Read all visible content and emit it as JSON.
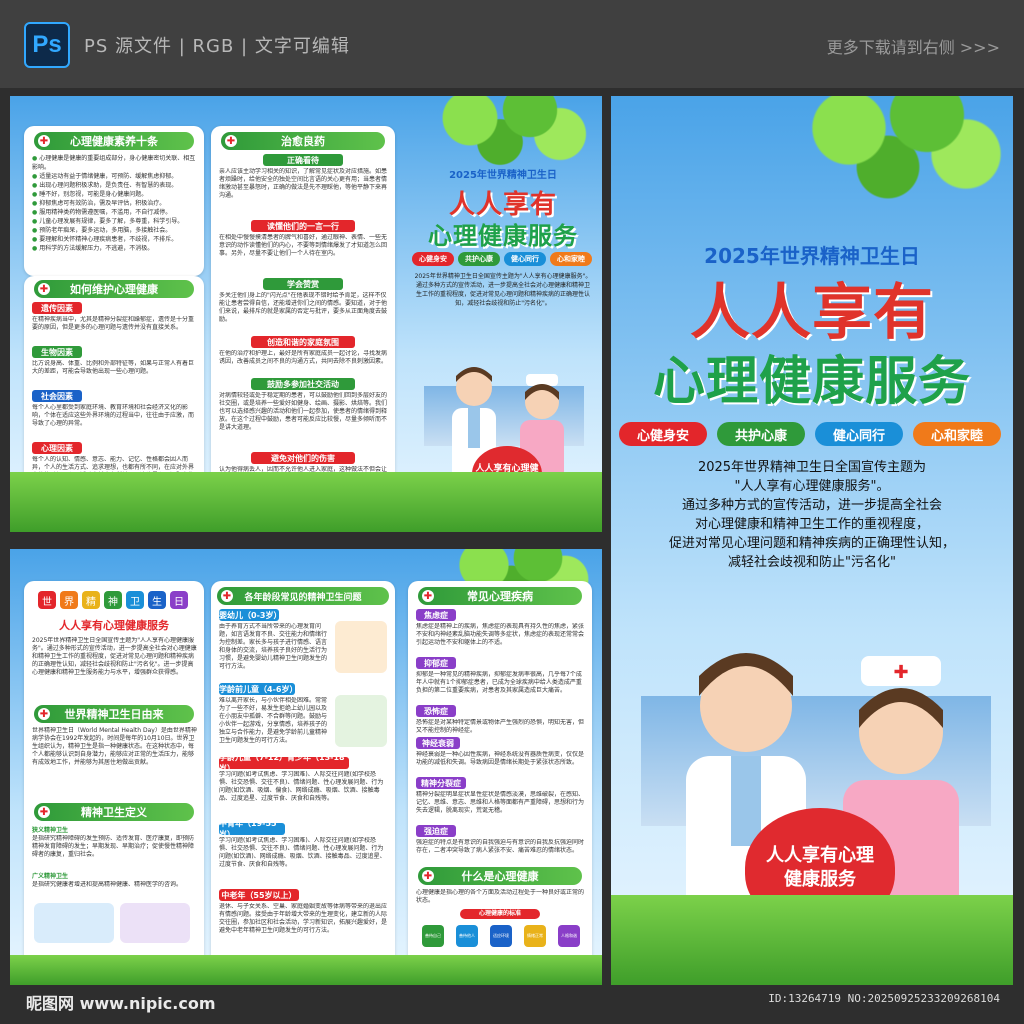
{
  "header": {
    "ps_label": "Ps",
    "left_text": "PS 源文件 | RGB | 文字可编辑",
    "right_text": "更多下载请到右侧 >>>"
  },
  "panel1": {
    "card1": {
      "title": "心理健康素养十条",
      "items": [
        "心理健康是健康的重要组成部分，身心健康密切关联、相互影响。",
        "适量运动有益于情绪健康，可预防、缓解焦虑抑郁。",
        "出现心理问题积极求助，是负责任、有智慧的表现。",
        "睡不好，别忽视，可能是身心健康问题。",
        "抑郁焦虑可有效防治，需及早评估，积极治疗。",
        "服用精神类药物需遵医嘱，不滥用，不自行减停。",
        "儿童心理发展有规律，要多了解，多尊重，科学引导。",
        "预防老年痴呆，要多运动，多用脑，多接触社会。",
        "要理解和关怀精神心理疾病患者，不歧视，不排斥。",
        "用科学的方法缓解压力，不逃避，不消极。"
      ]
    },
    "card2": {
      "title": "如何维护心理健康",
      "sections": [
        {
          "label": "遗传因素",
          "text": "在精神疾病当中，尤其是精神分裂症和躁郁症，遗传是十分重要的原因，但是更多的心理问题与遗传并没有直接关系。"
        },
        {
          "label": "生物因素",
          "text": "比方说身高、体重、比例和外部特征等，如果与正常人有着巨大的差距，可能会导致他出现一些心理问题。"
        },
        {
          "label": "社会因素",
          "text": "每个人心里都受到家庭环境、教育环境和社会经济文化的影响，个体在适应这些外界环境的过程当中，往往由于应激，而导致了心理的异常。"
        },
        {
          "label": "心理因素",
          "text": "每个人的认知、情感、意志、能力、记忆、性格都会因人而异，个人的生活方式、追求理想，也都有所不同，在应对外界事件的时候，心理活动自然会有所差异，这也是心理问题产生的一个重要原因。"
        }
      ]
    },
    "card3": {
      "title": "治愈良药",
      "sections": [
        {
          "label": "正确看待",
          "text": "亲人应该主动学习相关的知识，了解常见症状及对应措施。如患者烦躁时，给他安全的独处空间比言语的关心更有用；当患者情绪激动甚至暴怒时，正确的做法是先不理睬他，等他平静下来再沟通。"
        },
        {
          "label": "读懂他们的一言一行",
          "text": "在相处中慢慢摸清患者的脾气和喜好，通过眼神、表情、一些无意识的动作读懂他们的内心，不要等到情绪爆发了才知道怎么回事。另外，尽量不要让他们一个人待在室内。"
        },
        {
          "label": "学会赞赏",
          "text": "多关注他们身上的\"闪光点\"在他表现不错时给予肯定，这样不仅能让患者尝得自信，还能增进你们之间的情感。要知道，对于他们来说，最排斥的就是家属的否定与批评，要多从正面角度去鼓励。"
        },
        {
          "label": "创造和谐的家庭氛围",
          "text": "在他的治疗和护理上，最好是所有家庭成员一起讨论，寻找发病诱因，改善成员之间不良的沟通方式，共同去除不良刺激因素。"
        },
        {
          "label": "鼓励多参加社交活动",
          "text": "对病情较轻或处于稳定期的患者，可以鼓励他们回到多层好友的社交圈，或是培养一些爱好如健身、绘画、摄影、烘焙等。我们也可以选择感兴趣的活动和他们一起参加，使患者的情绪得到释放。在这个过程中鼓励，患者可能反应比较慢，尽量多倾听而不是讲大道理。"
        },
        {
          "label": "避免对他们的伤害",
          "text": "认为他得病丢人，因而不允许他人进入家庭，这种做法不但会让患者自己不被家人接受，绝对不说带有伤害性的话语。"
        }
      ]
    },
    "cover": {
      "year": "2025年世界精神卫生日",
      "title1": "人人享有",
      "title2": "心理健康服务",
      "pills": [
        "心健身安",
        "共护心康",
        "健心同行",
        "心和家睦"
      ],
      "text": "2025年世界精神卫生日全国宣传主题为\"人人享有心理健康服务\"。通过多种方式的宣传活动，进一步提高全社会对心理健康和精神卫生工作的重视程度，促进对常见心理问题和精神疾病的正确理性认知，减轻社会歧视和防止\"污名化\"。",
      "heart": "人人享有心理健康服务"
    }
  },
  "panel2": {
    "left": {
      "badge_chars": [
        "世",
        "界",
        "精",
        "神",
        "卫",
        "生",
        "日"
      ],
      "title": "人人享有心理健康服务",
      "intro": "2025年世界精神卫生日全国宣传主题为\"人人享有心理健康服务\"。通过多种形式的宣传活动，进一步提高全社会对心理健康和精神卫生工作的重视程度，促进对常见心理问题和精神疾病的正确理性认知，减轻社会歧视和防止\"污名化\"。进一步提高心理健康和精神卫生服务能力与水平，增强群众获得感。",
      "origin_title": "世界精神卫生日由来",
      "origin_text": "世界精神卫生日（World Mental Health Day）是由世界精神病学协会在1992年发起的，时间是每年的10月10日。世界卫生组织认为，精神卫生是指一种健康状态。在这种状态中，每个人都能够认识到自身潜力，能够应对正常的生活压力，能够有成效地工作，并能够为其居住地做出贡献。",
      "def_title": "精神卫生定义",
      "def_items": [
        {
          "label": "狭义精神卫生",
          "text": "是指研究精神障碍的发生预防、适传发育、医疗康复，即预防精神发育障碍的发生；早期发现、早期治疗；促使慢性精神障碍者的康复，重归社会。"
        },
        {
          "label": "广义精神卫生",
          "text": "是指研究健康者增进和提高精神健康、精神医学的咨询。"
        }
      ]
    },
    "middle": {
      "title": "各年龄段常见的精神卫生问题",
      "sections": [
        {
          "label": "婴幼儿（0-3岁）",
          "text": "由于养育方式不当所带来的心理发育问题，如言语发育不良、交往能力和情绪行为控制差。家长多与孩子进行情感、语言和身体的交流，培养孩子良好的生活行为习惯，是避免婴幼儿精神卫生问题发生的可行方法。"
        },
        {
          "label": "学龄前儿童（4-6岁）",
          "text": "难以离开家长，与小伙伴相处困难。常常为了一些不好，易发生拒绝上幼儿园以及在小朋友中孤僻、不合群等问题。鼓励与小伙伴一起游戏，分享情感，培养孩子的独立与合作能力，是避免学龄前儿童精神卫生问题发生的可行方法。"
        },
        {
          "label": "学龄儿童（7-12）青少年（13-18岁）",
          "text": "学习问题(如考试焦虑、学习困难)、人际交往问题(如学校恐惧、社交恐惧、交往不良)、情绪问题、性心理发展问题、行为问题(如饮酒、吸烟、偏食)、网络成瘾、吸烟、饮酒、接触毒品、过度追星、过度节食、厌食和自残等。"
        },
        {
          "label": "中青年（19-55岁）",
          "text": "学习问题(如考试焦虑、学习困难)、人际交往问题(如学校恐惧、社交恐惧、交往不良)、情绪问题、性心理发展问题、行为问题(如饮酒)、网络成瘾、吸烟、饮酒、接触毒品、过度追星、过度节食、厌食和自残等。"
        },
        {
          "label": "中老年（55岁以上）",
          "text": "退休、与子女关系、空巢、家庭婚姻变故等体病等带来的退出应有情感问题。接受由于年龄增大带来的生理变化，建立新的人际交往圈，参加社区和社会活动，学习新知识，拓展兴趣爱好，是避免中老年精神卫生问题发生的可行方法。"
        }
      ]
    },
    "right": {
      "title": "常见心理疾病",
      "sections": [
        {
          "label": "焦虑症",
          "text": "焦虑症是精神上的疾病，焦虑症的表现具有持久性的焦虑，紧张不安和内神经紊乱脑功能失调等多症状，焦虑症的表现还常常会引起运动性不安和躯体上的不适。"
        },
        {
          "label": "抑郁症",
          "text": "抑郁是一种常见的精神疾病，抑郁症发病率很高，几乎每7个成年人中就有1个抑郁症患者，已成为全球疾病中给人类造成严重负担的第二位重要疾病，对患者及其家属造成巨大痛苦。"
        },
        {
          "label": "恐怖症",
          "text": "恐怖症是对某种特定情景或物体产生强烈的恐惧，明知无害，但又不能控制的神经症。"
        },
        {
          "label": "神经衰弱",
          "text": "神经衰弱是一种心因性疾病，神经系统没有器质性病变，仅仅是功能的减低和失调。导致病因是情绪长期处于紧张状态所致。"
        },
        {
          "label": "精神分裂症",
          "text": "精神分裂症明显症状显性症状是情感淡漠，思维破裂，在感知、记忆、思维、意志、思维和人格等面都有严重障碍，思想和行为失去逻辑，脱离现实，荒诞无稽。"
        },
        {
          "label": "强迫症",
          "text": "强迫症的特点是有意识的自我强迫与有意识的自我反抗强迫同时存在，二者冲突导致了病人紧张不安、痛苦难忍的情绪状态。"
        }
      ],
      "what_title": "什么是心理健康",
      "what_text": "心理健康是指心理的各个方面及活动过程处于一种良好或正常的状态。",
      "standard_title": "心理健康的标准",
      "standards": [
        "善待自己",
        "善待他人",
        "适应环境",
        "情绪正常",
        "人格和谐"
      ]
    }
  },
  "panel3": {
    "year": "2025年世界精神卫生日",
    "title1": "人人享有",
    "title2": "心理健康服务",
    "pills": [
      "心健身安",
      "共护心康",
      "健心同行",
      "心和家睦"
    ],
    "text_lines": [
      "2025年世界精神卫生日全国宣传主题为",
      "\"人人享有心理健康服务\"。",
      "通过多种方式的宣传活动，进一步提高全社会",
      "对心理健康和精神卫生工作的重视程度，",
      "促进对常见心理问题和精神疾病的正确理性认知，",
      "减轻社会歧视和防止\"污名化\""
    ],
    "heart": "人人享有心理健康服务"
  },
  "footer": {
    "left": "昵图网 www.nipic.com",
    "right": "ID:13264719 NO:20250925233209268104"
  },
  "colors": {
    "green": "#2f9a3a",
    "red": "#e0332b",
    "blue": "#1a62c8",
    "sky": "#4aa3e8"
  }
}
